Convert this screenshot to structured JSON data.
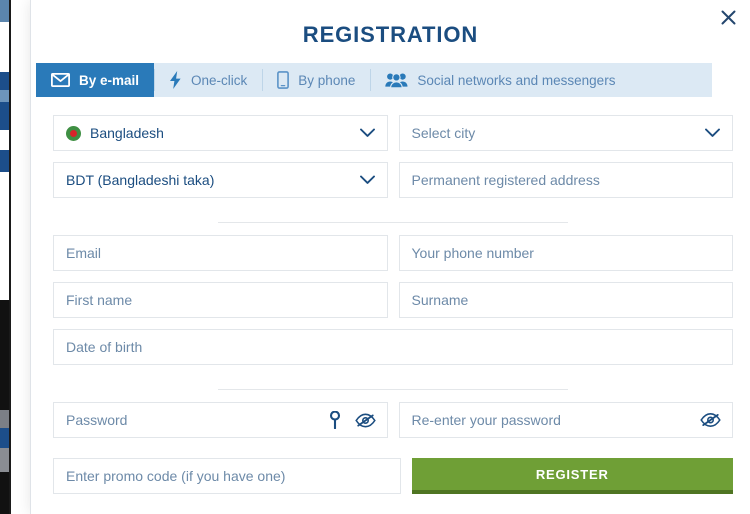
{
  "modal": {
    "title": "REGISTRATION",
    "close_icon": "close-icon"
  },
  "tabs": [
    {
      "label": "By e-mail",
      "icon": "envelope-icon",
      "active": true
    },
    {
      "label": "One-click",
      "icon": "lightning-bolt-icon",
      "active": false
    },
    {
      "label": "By phone",
      "icon": "mobile-phone-icon",
      "active": false
    },
    {
      "label": "Social networks and messengers",
      "icon": "people-group-icon",
      "active": false
    }
  ],
  "form": {
    "country": {
      "value": "Bangladesh",
      "flag": "bangladesh-flag-icon"
    },
    "city": {
      "placeholder": "Select city"
    },
    "currency": {
      "value": "BDT (Bangladeshi taka)"
    },
    "address": {
      "placeholder": "Permanent registered address"
    },
    "email": {
      "placeholder": "Email"
    },
    "phone": {
      "placeholder": "Your phone number"
    },
    "first_name": {
      "placeholder": "First name"
    },
    "surname": {
      "placeholder": "Surname"
    },
    "date_of_birth": {
      "placeholder": "Date of birth"
    },
    "password": {
      "placeholder": "Password",
      "key_icon": "key-icon",
      "reveal_icon": "eye-slash-icon"
    },
    "confirm_password": {
      "placeholder": "Re-enter your password",
      "reveal_icon": "eye-slash-icon"
    },
    "promo_code": {
      "placeholder": "Enter promo code (if you have one)"
    },
    "submit_label": "REGISTER"
  },
  "colors": {
    "accent_blue": "#2a7ab9",
    "title_blue": "#1b4d80",
    "tab_bar_bg": "#dce9f4",
    "register_green": "#6f9f36",
    "register_green_dark": "#4f7522"
  }
}
